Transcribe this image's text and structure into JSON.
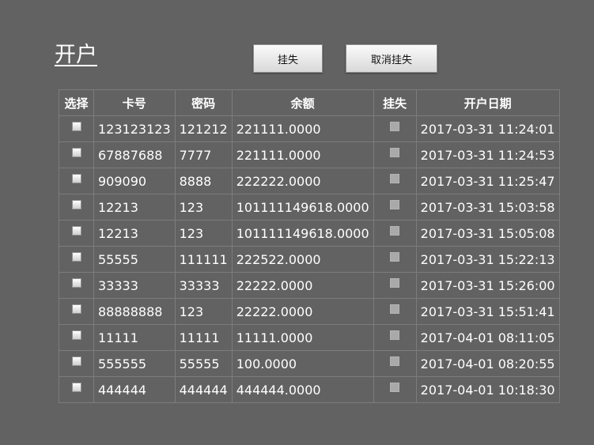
{
  "page": {
    "title": "开户"
  },
  "actions": {
    "report_loss_label": "挂失",
    "cancel_loss_label": "取消挂失"
  },
  "table": {
    "columns": [
      "选择",
      "卡号",
      "密码",
      "余额",
      "挂失",
      "开户日期"
    ],
    "rows": [
      {
        "card": "123123123",
        "password": "121212",
        "balance": "221111.0000",
        "opened": "2017-03-31 11:24:01"
      },
      {
        "card": "67887688",
        "password": "7777",
        "balance": "221111.0000",
        "opened": "2017-03-31 11:24:53"
      },
      {
        "card": "909090",
        "password": "8888",
        "balance": "222222.0000",
        "opened": "2017-03-31 11:25:47"
      },
      {
        "card": "12213",
        "password": "123",
        "balance": "101111149618.0000",
        "opened": "2017-03-31 15:03:58"
      },
      {
        "card": "12213",
        "password": "123",
        "balance": "101111149618.0000",
        "opened": "2017-03-31 15:05:08"
      },
      {
        "card": "55555",
        "password": "111111",
        "balance": "222522.0000",
        "opened": "2017-03-31 15:22:13"
      },
      {
        "card": "33333",
        "password": "33333",
        "balance": "22222.0000",
        "opened": "2017-03-31 15:26:00"
      },
      {
        "card": "88888888",
        "password": "123",
        "balance": "22222.0000",
        "opened": "2017-03-31 15:51:41"
      },
      {
        "card": "11111",
        "password": "11111",
        "balance": "11111.0000",
        "opened": "2017-04-01 08:11:05"
      },
      {
        "card": "555555",
        "password": "55555",
        "balance": "100.0000",
        "opened": "2017-04-01 08:20:55"
      },
      {
        "card": "444444",
        "password": "444444",
        "balance": "444444.0000",
        "opened": "2017-04-01 10:18:30"
      }
    ]
  }
}
